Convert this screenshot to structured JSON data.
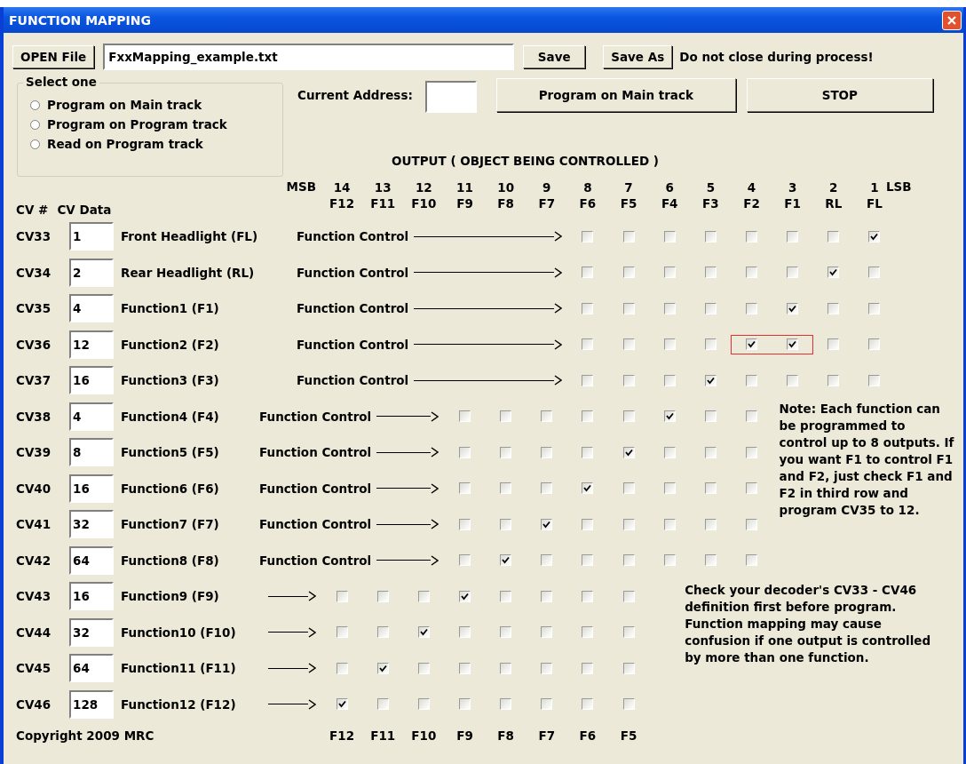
{
  "window": {
    "title": "FUNCTION MAPPING"
  },
  "file_bar": {
    "open_button": "OPEN File",
    "file_name": "FxxMapping_example.txt",
    "save_button": "Save",
    "save_as_button": "Save As",
    "warning": "Do not close during process!"
  },
  "mode_group": {
    "title": "Select one",
    "options": [
      {
        "label": "Program on Main track",
        "selected": false
      },
      {
        "label": "Program on Program track",
        "selected": false
      },
      {
        "label": "Read on Program track",
        "selected": false
      }
    ]
  },
  "address": {
    "label": "Current Address:"
  },
  "program_button": "Program on Main track",
  "stop_button": "STOP",
  "output_title": "OUTPUT ( OBJECT BEING CONTROLLED )",
  "table": {
    "cv_header": "CV #",
    "data_header": "CV Data",
    "msb": "MSB",
    "lsb": "LSB",
    "columns": [
      {
        "number": "14",
        "label": "F12"
      },
      {
        "number": "13",
        "label": "F11"
      },
      {
        "number": "12",
        "label": "F10"
      },
      {
        "number": "11",
        "label": "F9"
      },
      {
        "number": "10",
        "label": "F8"
      },
      {
        "number": "9",
        "label": "F7"
      },
      {
        "number": "8",
        "label": "F6"
      },
      {
        "number": "7",
        "label": "F5"
      },
      {
        "number": "6",
        "label": "F4"
      },
      {
        "number": "5",
        "label": "F3"
      },
      {
        "number": "4",
        "label": "F2"
      },
      {
        "number": "3",
        "label": "F1"
      },
      {
        "number": "2",
        "label": "RL"
      },
      {
        "number": "1",
        "label": "FL"
      }
    ],
    "rows": [
      {
        "kind": "upper",
        "cv": "CV33",
        "data": "1",
        "name": "Front Headlight (FL)",
        "control": "Function Control",
        "outputs": [
          {
            "checked": false
          },
          {
            "checked": false
          },
          {
            "checked": false
          },
          {
            "checked": false
          },
          {
            "checked": false
          },
          {
            "checked": false
          },
          {
            "checked": false
          },
          {
            "checked": true
          }
        ]
      },
      {
        "kind": "upper",
        "cv": "CV34",
        "data": "2",
        "name": "Rear Headlight (RL)",
        "control": "Function Control",
        "outputs": [
          {
            "checked": false
          },
          {
            "checked": false
          },
          {
            "checked": false
          },
          {
            "checked": false
          },
          {
            "checked": false
          },
          {
            "checked": false
          },
          {
            "checked": true
          },
          {
            "checked": false
          }
        ]
      },
      {
        "kind": "upper",
        "cv": "CV35",
        "data": "4",
        "name": "Function1 (F1)",
        "control": "Function Control",
        "outputs": [
          {
            "checked": false
          },
          {
            "checked": false
          },
          {
            "checked": false
          },
          {
            "checked": false
          },
          {
            "checked": false
          },
          {
            "checked": true
          },
          {
            "checked": false
          },
          {
            "checked": false
          }
        ]
      },
      {
        "kind": "upper",
        "cv": "CV36",
        "data": "12",
        "name": "Function2 (F2)",
        "control": "Function Control",
        "outputs": [
          {
            "checked": false
          },
          {
            "checked": false
          },
          {
            "checked": false
          },
          {
            "checked": false
          },
          {
            "checked": true,
            "highlighted": true
          },
          {
            "checked": true,
            "highlighted": true
          },
          {
            "checked": false
          },
          {
            "checked": false
          }
        ]
      },
      {
        "kind": "upper",
        "cv": "CV37",
        "data": "16",
        "name": "Function3 (F3)",
        "control": "Function Control",
        "outputs": [
          {
            "checked": false
          },
          {
            "checked": false
          },
          {
            "checked": false
          },
          {
            "checked": true
          },
          {
            "checked": false
          },
          {
            "checked": false
          },
          {
            "checked": false
          },
          {
            "checked": false
          }
        ]
      },
      {
        "kind": "middle",
        "cv": "CV38",
        "data": "4",
        "name": "Function4 (F4)",
        "control": "Function Control",
        "outputs": [
          {
            "checked": false
          },
          {
            "checked": false
          },
          {
            "checked": false
          },
          {
            "checked": false
          },
          {
            "checked": false
          },
          {
            "checked": true
          },
          {
            "checked": false
          },
          {
            "checked": false
          }
        ]
      },
      {
        "kind": "middle",
        "cv": "CV39",
        "data": "8",
        "name": "Function5 (F5)",
        "control": "Function Control",
        "outputs": [
          {
            "checked": false
          },
          {
            "checked": false
          },
          {
            "checked": false
          },
          {
            "checked": false
          },
          {
            "checked": true
          },
          {
            "checked": false
          },
          {
            "checked": false
          },
          {
            "checked": false
          }
        ]
      },
      {
        "kind": "middle",
        "cv": "CV40",
        "data": "16",
        "name": "Function6 (F6)",
        "control": "Function Control",
        "outputs": [
          {
            "checked": false
          },
          {
            "checked": false
          },
          {
            "checked": false
          },
          {
            "checked": true
          },
          {
            "checked": false
          },
          {
            "checked": false
          },
          {
            "checked": false
          },
          {
            "checked": false
          }
        ]
      },
      {
        "kind": "middle",
        "cv": "CV41",
        "data": "32",
        "name": "Function7 (F7)",
        "control": "Function Control",
        "outputs": [
          {
            "checked": false
          },
          {
            "checked": false
          },
          {
            "checked": true
          },
          {
            "checked": false
          },
          {
            "checked": false
          },
          {
            "checked": false
          },
          {
            "checked": false
          },
          {
            "checked": false
          }
        ]
      },
      {
        "kind": "middle",
        "cv": "CV42",
        "data": "64",
        "name": "Function8 (F8)",
        "control": "Function Control",
        "outputs": [
          {
            "checked": false
          },
          {
            "checked": true
          },
          {
            "checked": false
          },
          {
            "checked": false
          },
          {
            "checked": false
          },
          {
            "checked": false
          },
          {
            "checked": false
          },
          {
            "checked": false
          }
        ]
      },
      {
        "kind": "lower",
        "cv": "CV43",
        "data": "16",
        "name": "Function9 (F9)",
        "outputs": [
          {
            "checked": false
          },
          {
            "checked": false
          },
          {
            "checked": false
          },
          {
            "checked": true
          },
          {
            "checked": false
          },
          {
            "checked": false
          },
          {
            "checked": false
          },
          {
            "checked": false
          }
        ]
      },
      {
        "kind": "lower",
        "cv": "CV44",
        "data": "32",
        "name": "Function10 (F10)",
        "outputs": [
          {
            "checked": false
          },
          {
            "checked": false
          },
          {
            "checked": true
          },
          {
            "checked": false
          },
          {
            "checked": false
          },
          {
            "checked": false
          },
          {
            "checked": false
          },
          {
            "checked": false
          }
        ]
      },
      {
        "kind": "lower",
        "cv": "CV45",
        "data": "64",
        "name": "Function11 (F11)",
        "outputs": [
          {
            "checked": false
          },
          {
            "checked": true
          },
          {
            "checked": false
          },
          {
            "checked": false
          },
          {
            "checked": false
          },
          {
            "checked": false
          },
          {
            "checked": false
          },
          {
            "checked": false
          }
        ]
      },
      {
        "kind": "lower",
        "cv": "CV46",
        "data": "128",
        "name": "Function12 (F12)",
        "outputs": [
          {
            "checked": true
          },
          {
            "checked": false
          },
          {
            "checked": false
          },
          {
            "checked": false
          },
          {
            "checked": false
          },
          {
            "checked": false
          },
          {
            "checked": false
          },
          {
            "checked": false
          }
        ]
      }
    ],
    "footer_labels": [
      "F12",
      "F11",
      "F10",
      "F9",
      "F8",
      "F7",
      "F6",
      "F5"
    ]
  },
  "notes": [
    "Note: Each function can be programmed to control up to 8 outputs. If you want F1 to control F1 and F2, just check F1 and F2 in third row and program CV35 to 12.",
    "Check your decoder's CV33 - CV46 definition first before program. Function mapping may cause confusion if one output is controlled by more than one function."
  ],
  "copyright": "Copyright 2009 MRC"
}
